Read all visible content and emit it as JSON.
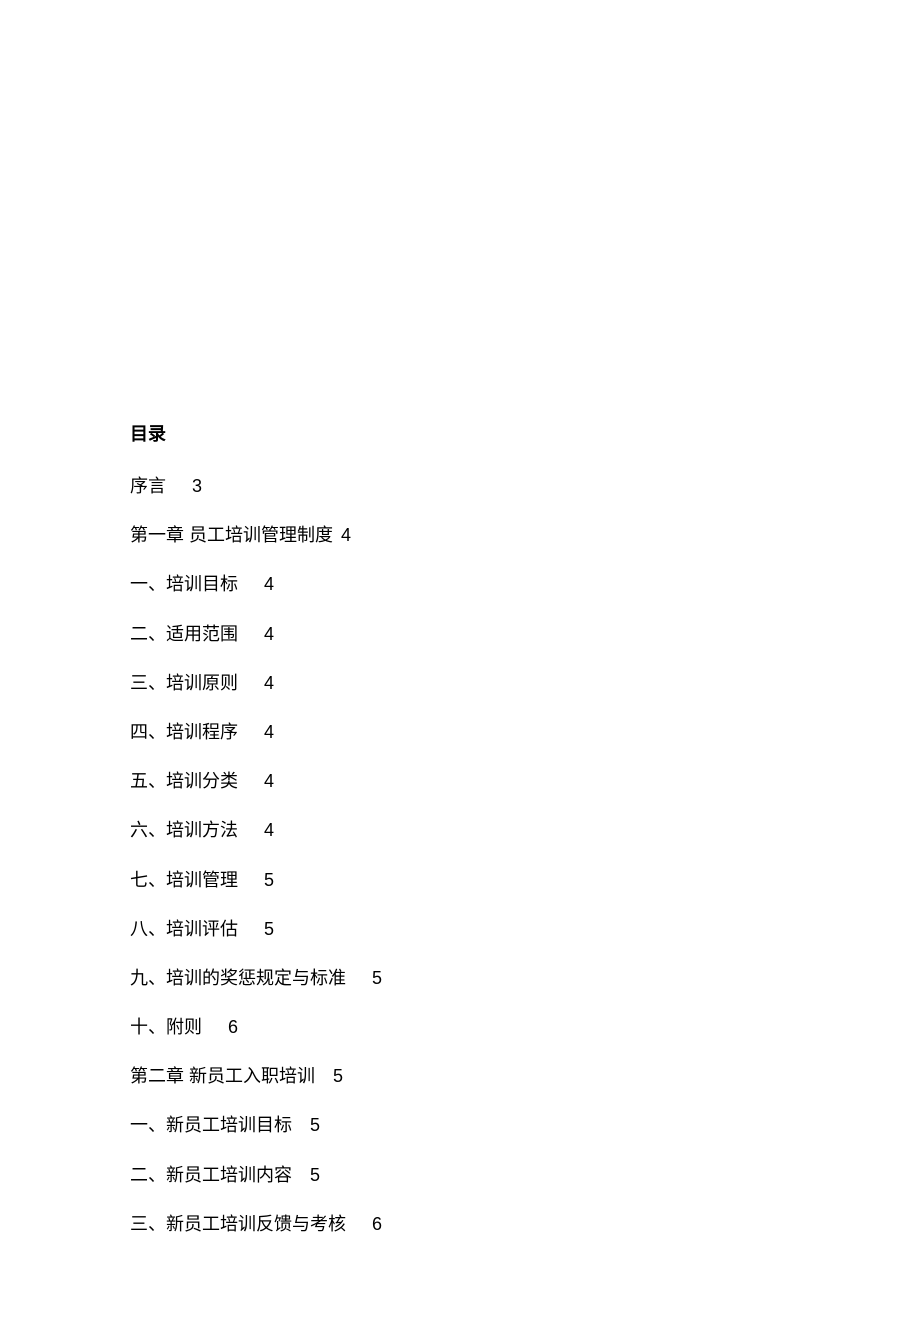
{
  "toc": {
    "title": "目录",
    "entries": [
      {
        "label": "序言",
        "page": "3",
        "spacing": "wide"
      },
      {
        "label": "第一章 员工培训管理制度",
        "page": "4",
        "spacing": "tight"
      },
      {
        "label": "一、培训目标",
        "page": "4",
        "spacing": "wide"
      },
      {
        "label": "二、适用范围",
        "page": "4",
        "spacing": "wide"
      },
      {
        "label": "三、培训原则",
        "page": "4",
        "spacing": "wide"
      },
      {
        "label": "四、培训程序",
        "page": "4",
        "spacing": "wide"
      },
      {
        "label": "五、培训分类",
        "page": "4",
        "spacing": "wide"
      },
      {
        "label": "六、培训方法",
        "page": "4",
        "spacing": "wide"
      },
      {
        "label": "七、培训管理",
        "page": "5",
        "spacing": "wide"
      },
      {
        "label": "八、培训评估",
        "page": "5",
        "spacing": "wide"
      },
      {
        "label": "九、培训的奖惩规定与标准",
        "page": "5",
        "spacing": "wide"
      },
      {
        "label": "十、附则",
        "page": "6",
        "spacing": "wide"
      },
      {
        "label": "第二章 新员工入职培训",
        "page": "5",
        "spacing": "normal"
      },
      {
        "label": "一、新员工培训目标",
        "page": "5",
        "spacing": "normal"
      },
      {
        "label": "二、新员工培训内容",
        "page": "5",
        "spacing": "normal"
      },
      {
        "label": "三、新员工培训反馈与考核",
        "page": "6",
        "spacing": "wide"
      }
    ]
  }
}
